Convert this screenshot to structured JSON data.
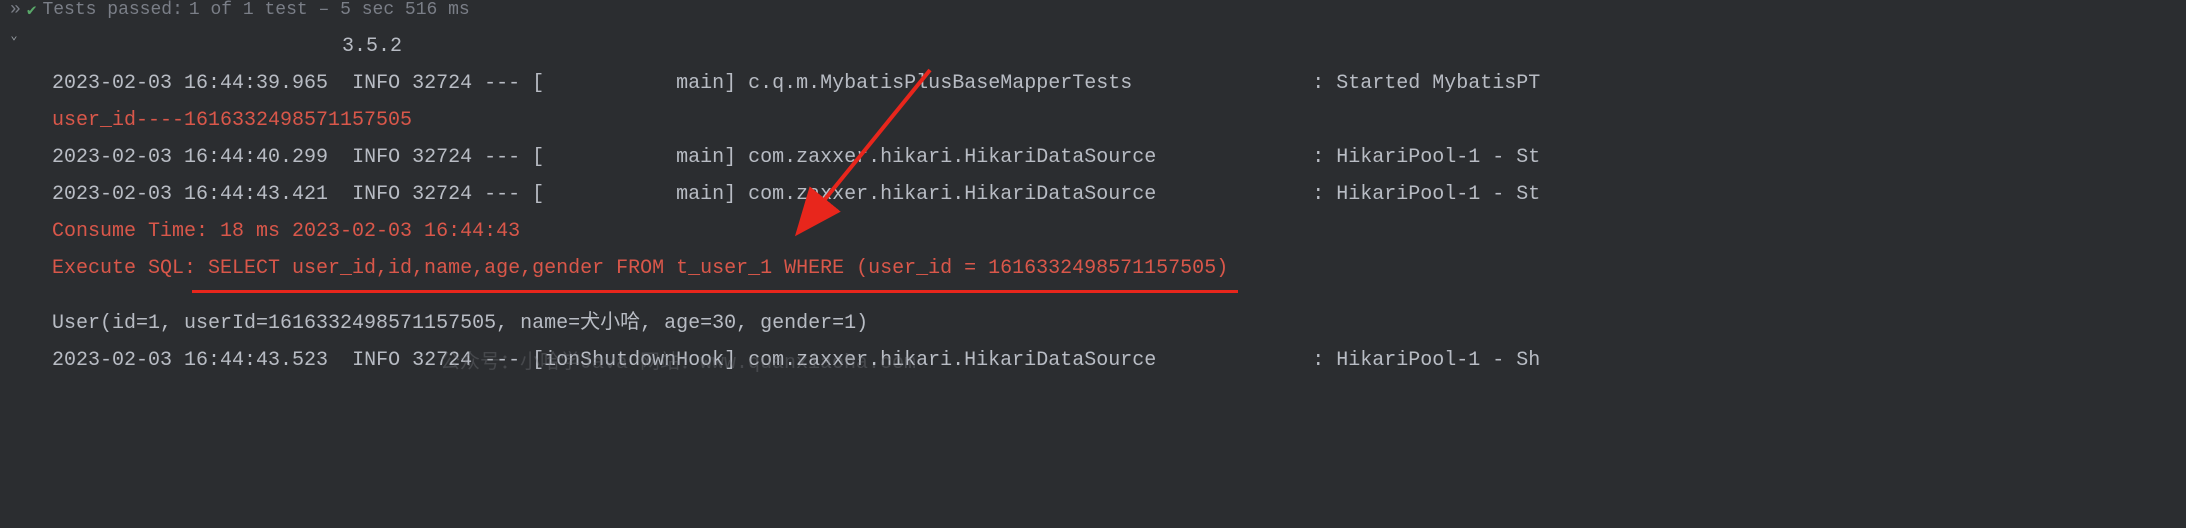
{
  "status": {
    "label": "Tests passed:",
    "detail": "1 of 1 test – 5 sec 516 ms"
  },
  "version": "3.5.2",
  "lines": {
    "l1_ts": "2023-02-03 16:44:39.965",
    "l1_level": "INFO 32724 --- [",
    "l1_thread": "main]",
    "l1_logger": "c.q.m.MybatisPlusBaseMapperTests",
    "l1_msg": ": Started MybatisPT",
    "l2": "user_id----1616332498571157505",
    "l3_ts": "2023-02-03 16:44:40.299",
    "l3_level": "INFO 32724 --- [",
    "l3_thread": "main]",
    "l3_logger": "com.zaxxer.hikari.HikariDataSource",
    "l3_msg": ": HikariPool-1 - St",
    "l4_ts": "2023-02-03 16:44:43.421",
    "l4_level": "INFO 32724 --- [",
    "l4_thread": "main]",
    "l4_logger": "com.zaxxer.hikari.HikariDataSource",
    "l4_msg": ": HikariPool-1 - St",
    "l5": " Consume Time: 18 ms 2023-02-03 16:44:43",
    "l6": " Execute SQL: SELECT user_id,id,name,age,gender FROM t_user_1 WHERE (user_id = 1616332498571157505)",
    "l7": "User(id=1, userId=1616332498571157505, name=犬小哈, age=30, gender=1)",
    "l8_ts": "2023-02-03 16:44:43.523",
    "l8_level": "INFO 32724 --- [",
    "l8_thread": "ionShutdownHook]",
    "l8_logger": "com.zaxxer.hikari.HikariDataSource",
    "l8_msg": ": HikariPool-1 - Sh"
  },
  "watermark": {
    "sub": "公众号：小哈学Java 网站：www.quanxiaoha.com"
  }
}
